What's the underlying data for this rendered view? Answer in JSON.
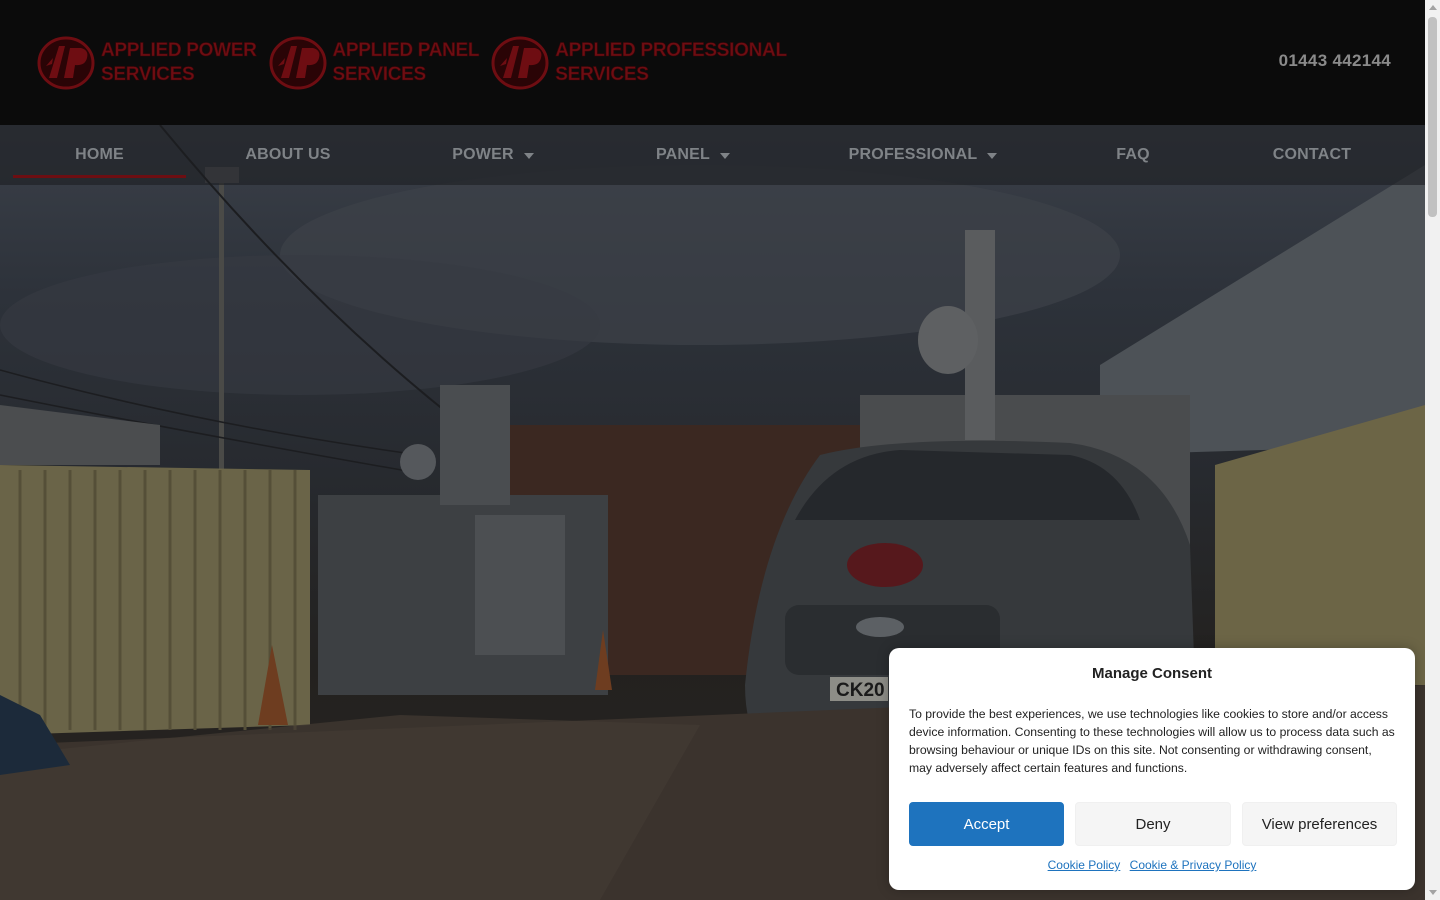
{
  "header": {
    "logos": [
      {
        "line1": "APPLIED POWER",
        "line2": "SERVICES"
      },
      {
        "line1": "APPLIED PANEL",
        "line2": "SERVICES"
      },
      {
        "line1": "APPLIED PROFESSIONAL",
        "line2": "SERVICES"
      }
    ],
    "phone": "01443 442144"
  },
  "nav": {
    "items": [
      {
        "label": "HOME",
        "active": true,
        "dropdown": false
      },
      {
        "label": "ABOUT US",
        "active": false,
        "dropdown": false
      },
      {
        "label": "POWER",
        "active": false,
        "dropdown": true
      },
      {
        "label": "PANEL",
        "active": false,
        "dropdown": true
      },
      {
        "label": "PROFESSIONAL",
        "active": false,
        "dropdown": true
      },
      {
        "label": "FAQ",
        "active": false,
        "dropdown": false
      },
      {
        "label": "CONTACT",
        "active": false,
        "dropdown": false
      }
    ]
  },
  "hero": {
    "van_plate": "CK20"
  },
  "consent": {
    "title": "Manage Consent",
    "body": "To provide the best experiences, we use technologies like cookies to store and/or access device information. Consenting to these technologies will allow us to process data such as browsing behaviour or unique IDs on this site. Not consenting or withdrawing consent, may adversely affect certain features and functions.",
    "accept_label": "Accept",
    "deny_label": "Deny",
    "preferences_label": "View preferences",
    "links": [
      "Cookie Policy",
      "Cookie & Privacy Policy"
    ]
  },
  "colors": {
    "brand_red": "#6e0d12",
    "accept_blue": "#1e73be",
    "header_bg": "#0b0b0b"
  }
}
